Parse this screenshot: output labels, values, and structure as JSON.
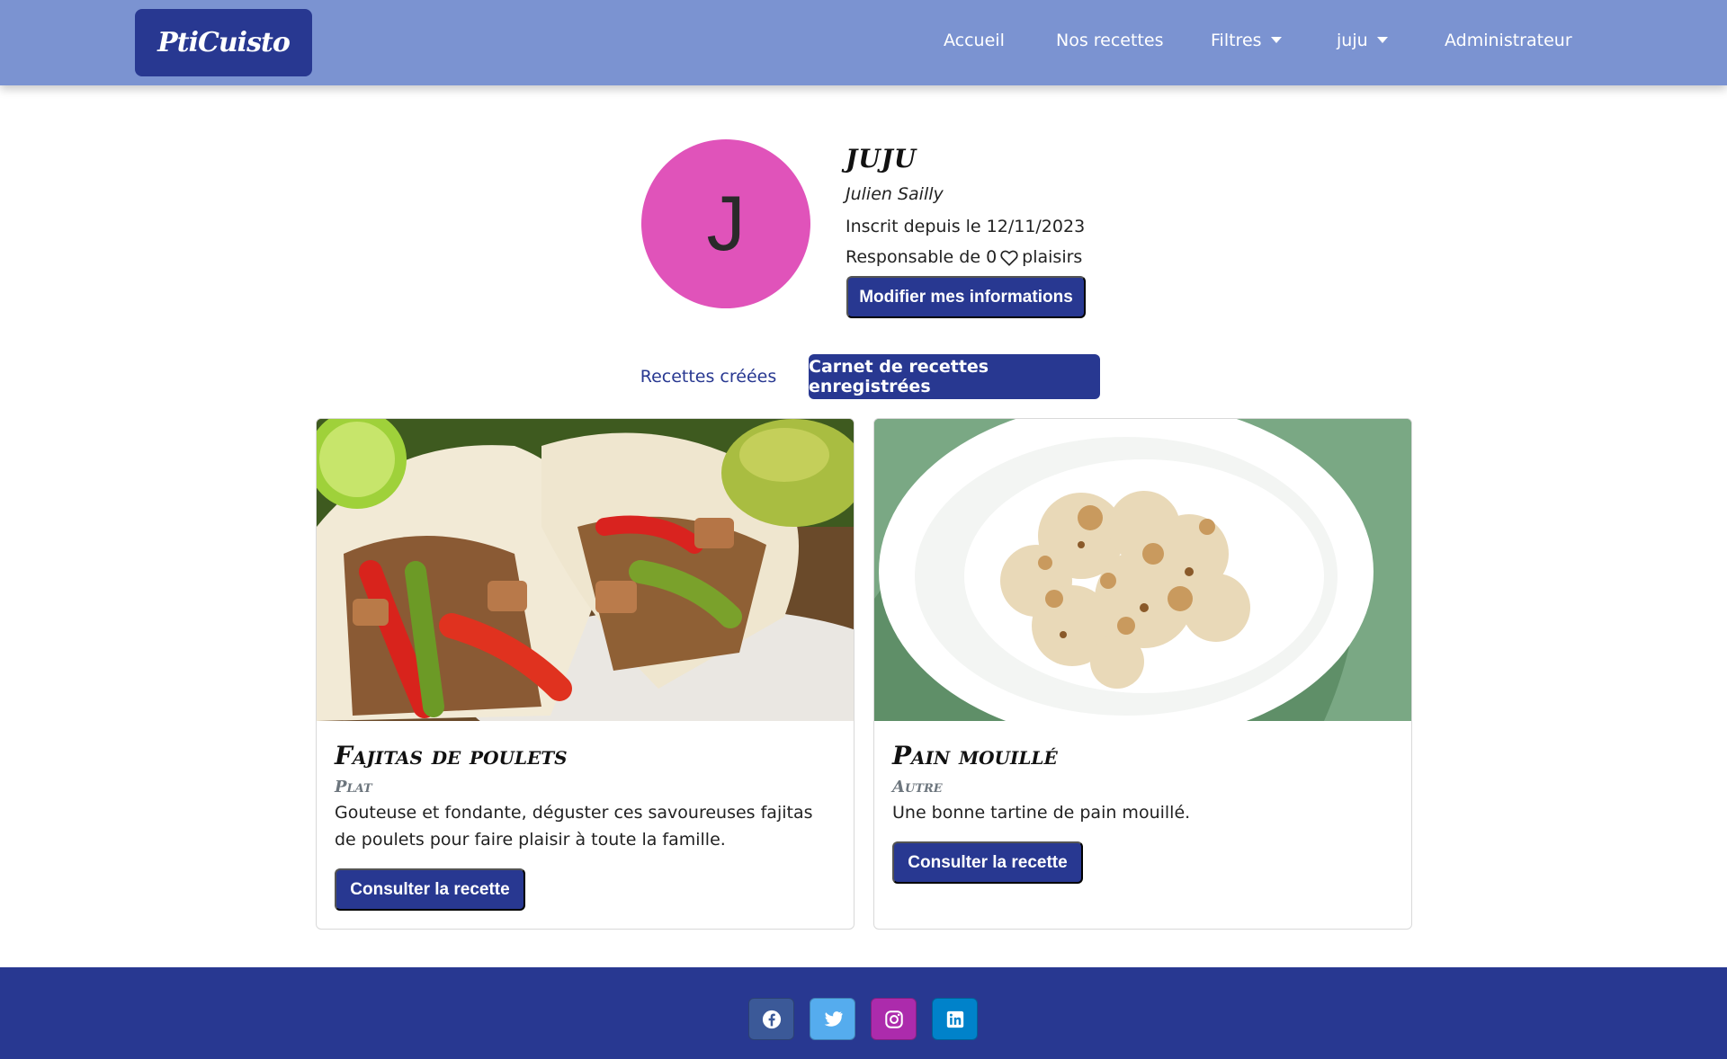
{
  "brand": {
    "name": "PtiCuisto"
  },
  "nav": {
    "home": "Accueil",
    "recipes": "Nos recettes",
    "filters": "Filtres",
    "user": "juju",
    "admin": "Administrateur"
  },
  "profile": {
    "initial": "J",
    "username": "JUJU",
    "fullname": "Julien Sailly",
    "since": "Inscrit depuis le 12/11/2023",
    "responsible_prefix": "Responsable de 0",
    "responsible_suffix": "plaisirs",
    "edit_button": "Modifier mes informations"
  },
  "tabs": {
    "created": "Recettes créées",
    "saved": "Carnet de recettes enregistrées"
  },
  "cards": [
    {
      "title": "Fajitas de poulets",
      "category": "Plat",
      "description": "Gouteuse et fondante, déguster ces savoureuses fajitas de poulets pour faire plaisir à toute la famille.",
      "button": "Consulter la recette"
    },
    {
      "title": "Pain mouillé",
      "category": "Autre",
      "description": "Une bonne tartine de pain mouillé.",
      "button": "Consulter la recette"
    }
  ],
  "footer": {
    "socials": [
      "facebook-icon",
      "twitter-icon",
      "instagram-icon",
      "linkedin-icon"
    ]
  },
  "colors": {
    "navbar": "#7b93d1",
    "primary": "#283891",
    "avatar": "#e053ba",
    "facebook": "#3b5998",
    "twitter": "#55acee",
    "instagram": "#ac2bac",
    "linkedin": "#0082ca"
  }
}
